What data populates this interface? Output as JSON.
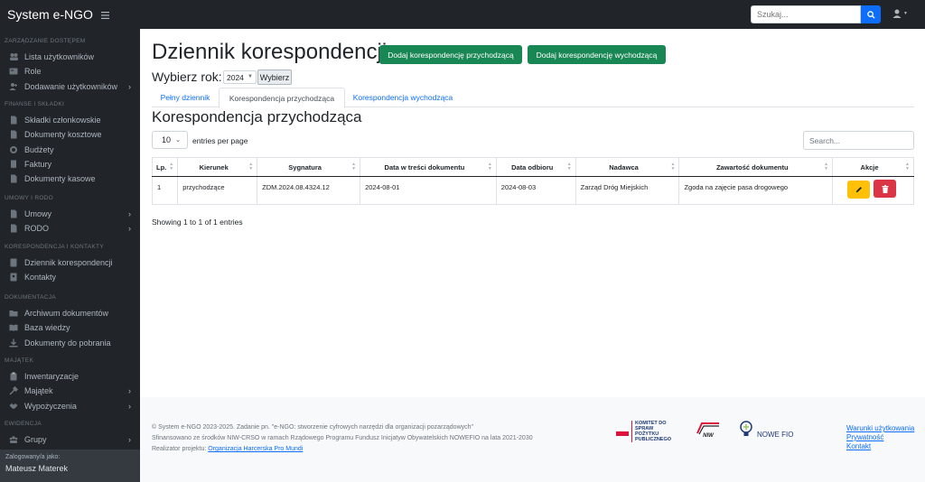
{
  "app": {
    "brand": "System e-NGO",
    "search_placeholder": "Szukaj..."
  },
  "sidebar": {
    "sections": [
      {
        "heading": "ZARZĄDZANIE DOSTĘPEM",
        "items": [
          {
            "label": "Lista użytkowników",
            "icon": "users-icon"
          },
          {
            "label": "Role",
            "icon": "id-card-icon"
          },
          {
            "label": "Dodawanie użytkowników",
            "icon": "user-plus-icon",
            "chevron": true
          }
        ]
      },
      {
        "heading": "FINANSE I SKŁADKI",
        "items": [
          {
            "label": "Składki członkowskie",
            "icon": "document-icon"
          },
          {
            "label": "Dokumenty kosztowe",
            "icon": "document-icon"
          },
          {
            "label": "Budżety",
            "icon": "coins-icon"
          },
          {
            "label": "Faktury",
            "icon": "invoice-icon"
          },
          {
            "label": "Dokumenty kasowe",
            "icon": "document-icon"
          }
        ]
      },
      {
        "heading": "UMOWY I RODO",
        "items": [
          {
            "label": "Umowy",
            "icon": "document-icon",
            "chevron": true
          },
          {
            "label": "RODO",
            "icon": "document-icon",
            "chevron": true
          }
        ]
      },
      {
        "heading": "KORESPONDENCJA I KONTAKTY",
        "items": [
          {
            "label": "Dziennik korespondencji",
            "icon": "book-icon"
          },
          {
            "label": "Kontakty",
            "icon": "address-book-icon"
          }
        ]
      },
      {
        "heading": "DOKUMENTACJA",
        "items": [
          {
            "label": "Archiwum dokumentów",
            "icon": "folder-icon"
          },
          {
            "label": "Baza wiedzy",
            "icon": "book-open-icon"
          },
          {
            "label": "Dokumenty do pobrania",
            "icon": "download-icon"
          }
        ]
      },
      {
        "heading": "MAJĄTEK",
        "items": [
          {
            "label": "Inwentaryzacje",
            "icon": "clipboard-icon"
          },
          {
            "label": "Majątek",
            "icon": "tools-icon",
            "chevron": true
          },
          {
            "label": "Wypożyczenia",
            "icon": "handshake-icon",
            "chevron": true
          }
        ]
      },
      {
        "heading": "EWIDENCJA",
        "items": [
          {
            "label": "Grupy",
            "icon": "group-icon",
            "chevron": true
          }
        ]
      }
    ],
    "footer": {
      "logged_label": "Zalogowany/a jako:",
      "user_name": "Mateusz Materek"
    }
  },
  "page": {
    "title": "Dziennik korespondencji",
    "add_incoming": "Dodaj korespondencję przychodzącą",
    "add_outgoing": "Dodaj korespondencję wychodzącą",
    "year_label": "Wybierz rok:",
    "year_value": "2024",
    "choose_button": "Wybierz",
    "tabs": [
      {
        "label": "Pełny dziennik",
        "active": false
      },
      {
        "label": "Korespondencja przychodząca",
        "active": true
      },
      {
        "label": "Korespondencja wychodząca",
        "active": false
      }
    ],
    "section_title": "Korespondencja przychodząca"
  },
  "table": {
    "page_size": "10",
    "entries_label": "entries per page",
    "search_placeholder": "Search...",
    "columns": [
      "Lp.",
      "Kierunek",
      "Sygnatura",
      "Data w treści dokumentu",
      "Data odbioru",
      "Nadawca",
      "Zawartość dokumentu",
      "Akcje"
    ],
    "rows": [
      {
        "lp": "1",
        "kierunek": "przychodzące",
        "sygnatura": "ZDM.2024.08.4324.12",
        "data_tresci": "2024-08-01",
        "data_odbioru": "2024-08-03",
        "nadawca": "Zarząd Dróg Miejskich",
        "zawartosc": "Zgoda na zajęcie pasa drogowego"
      }
    ],
    "showing": "Showing 1 to 1 of 1 entries"
  },
  "footer": {
    "line1": "© System e-NGO 2023-2025. Zadanie pn. \"e-NGO: stworzenie cyfrowych narzędzi dla organizacji pozarządowych\"",
    "line2": "Sfinansowano ze środków NIW-CRSO w ramach Rządowego Programu Fundusz Inicjatyw Obywatelskich NOWEFIO na lata 2021-2030",
    "line3_prefix": "Realizator projektu: ",
    "line3_link": "Organizacja Harcerska Pro Mundi",
    "logo1_text": "KOMITET DO SPRAW POŻYTKU PUBLICZNEGO",
    "logo2_text": "NIW",
    "logo3_text": "NOWE FIO",
    "links": [
      "Warunki użytkowania",
      "Prywatność",
      "Kontakt"
    ]
  },
  "colors": {
    "primary": "#0d6efd",
    "success": "#198754",
    "warning": "#ffc107",
    "danger": "#dc3545",
    "dark": "#212529"
  }
}
